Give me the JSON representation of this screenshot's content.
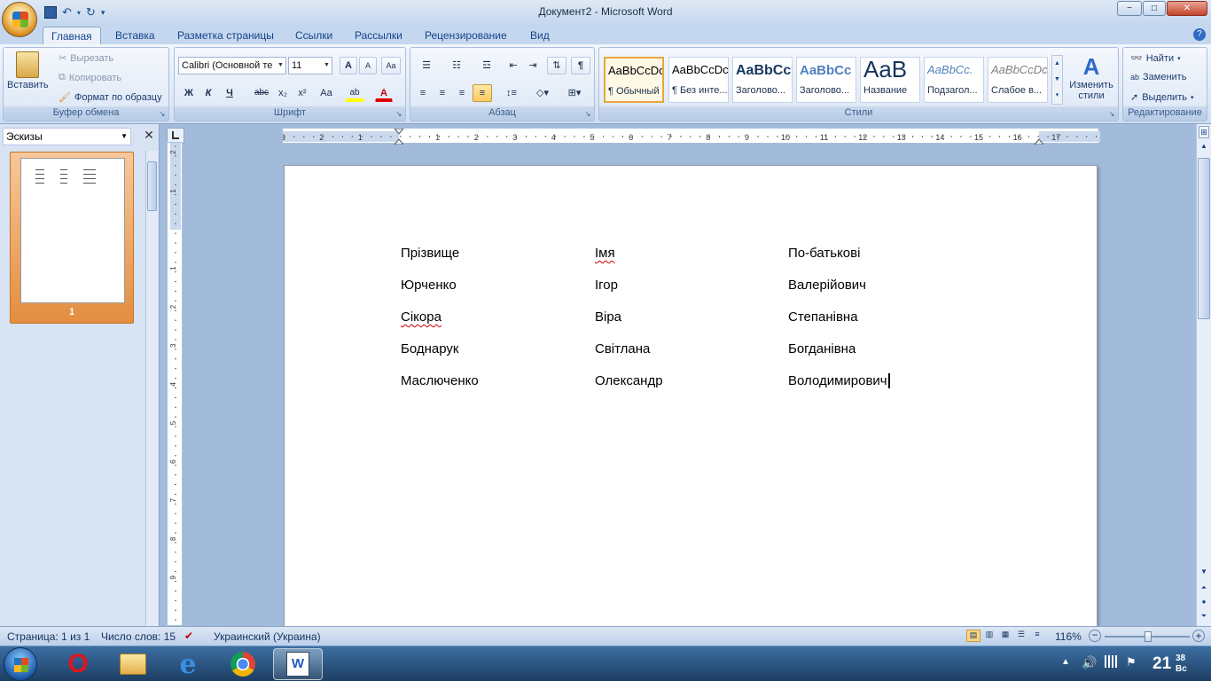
{
  "app": {
    "title": "Документ2 - Microsoft Word"
  },
  "window_controls": {
    "minimize": "−",
    "maximize": "□",
    "close": "✕"
  },
  "tabs": [
    {
      "label": "Главная",
      "active": true
    },
    {
      "label": "Вставка"
    },
    {
      "label": "Разметка страницы"
    },
    {
      "label": "Ссылки"
    },
    {
      "label": "Рассылки"
    },
    {
      "label": "Рецензирование"
    },
    {
      "label": "Вид"
    }
  ],
  "clipboard": {
    "paste": "Вставить",
    "cut": "Вырезать",
    "copy": "Копировать",
    "format_painter": "Формат по образцу",
    "group_label": "Буфер обмена"
  },
  "font": {
    "name": "Calibri (Основной те",
    "size": "11",
    "grow": "A",
    "shrink": "A",
    "clear": "Aa",
    "bold": "Ж",
    "italic": "К",
    "underline": "Ч",
    "strike": "abc",
    "subscript": "x₂",
    "superscript": "x²",
    "case": "Aa",
    "highlight": "ab",
    "color": "A",
    "group_label": "Шрифт"
  },
  "paragraph": {
    "group_label": "Абзац",
    "pilcrow": "¶"
  },
  "styles": {
    "items": [
      {
        "preview": "AaBbCcDc",
        "name": "¶ Обычный",
        "selected": true
      },
      {
        "preview": "AaBbCcDc",
        "name": "¶ Без инте..."
      },
      {
        "preview": "AaBbCc",
        "name": "Заголово..."
      },
      {
        "preview": "AaBbCc",
        "name": "Заголово..."
      },
      {
        "preview": "AaB",
        "name": "Название"
      },
      {
        "preview": "AaBbCc.",
        "name": "Подзагол..."
      },
      {
        "preview": "AaBbCcDc",
        "name": "Слабое в..."
      }
    ],
    "change_styles": "Изменить стили",
    "group_label": "Стили"
  },
  "editing": {
    "find": "Найти",
    "replace": "Заменить",
    "select": "Выделить",
    "group_label": "Редактирование"
  },
  "thumbs": {
    "title": "Эскизы",
    "page_number": "1"
  },
  "ruler": {
    "labels": [
      "3",
      "2",
      "1",
      "1",
      "2",
      "3",
      "4",
      "5",
      "6",
      "7",
      "8",
      "9",
      "10",
      "11",
      "12",
      "13",
      "14",
      "15",
      "16",
      "17"
    ],
    "vlabels": [
      "2",
      "1",
      "1",
      "2",
      "3",
      "4",
      "5",
      "6",
      "7",
      "8",
      "9"
    ]
  },
  "document": {
    "rows": [
      [
        "Прізвище",
        "Імя",
        "По-батькові"
      ],
      [
        "Юрченко",
        "Ігор",
        "Валерійович"
      ],
      [
        "Сікора",
        "Віра",
        "Степанівна"
      ],
      [
        "Боднарук",
        "Світлана",
        "Богданівна"
      ],
      [
        "Маслюченко",
        "Олександр",
        "Володимирович"
      ]
    ]
  },
  "status": {
    "page": "Страница: 1 из 1",
    "words": "Число слов: 15",
    "language": "Украинский (Украина)",
    "zoom": "116%"
  },
  "taskbar": {
    "items": [
      "start-button",
      "opera",
      "explorer",
      "ie",
      "chrome",
      "word"
    ],
    "clock": "21",
    "clock_minutes": "38",
    "clock_day": "Вс"
  },
  "colors": {
    "ribbon_text": "#15428b",
    "accent": "#e8a73a",
    "spell_error": "#d00000"
  }
}
